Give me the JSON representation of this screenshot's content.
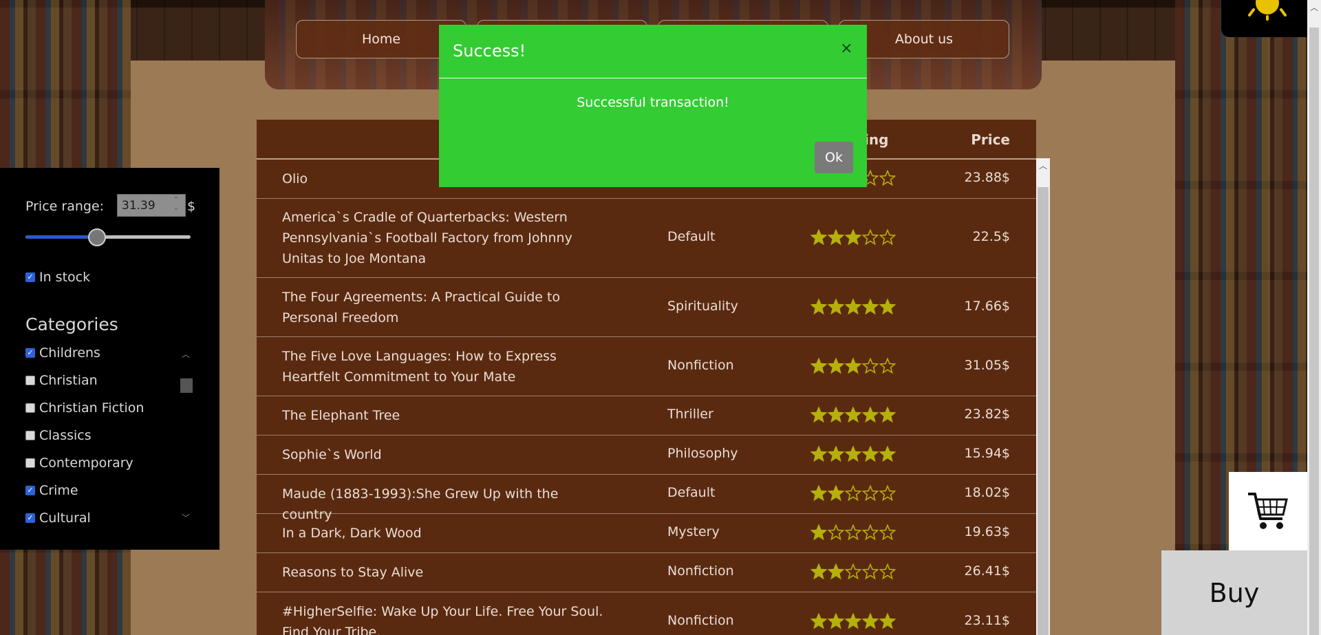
{
  "nav": {
    "items": [
      "Home",
      "",
      "",
      "About us"
    ]
  },
  "filters": {
    "price_label": "Price range:",
    "price_value": "31.39",
    "currency": "$",
    "slider_fraction": 0.43,
    "in_stock_label": "In stock",
    "in_stock_checked": true,
    "categories_title": "Categories",
    "categories": [
      {
        "label": "Childrens",
        "checked": true
      },
      {
        "label": "Christian",
        "checked": false
      },
      {
        "label": "Christian Fiction",
        "checked": false
      },
      {
        "label": "Classics",
        "checked": false
      },
      {
        "label": "Contemporary",
        "checked": false
      },
      {
        "label": "Crime",
        "checked": true
      },
      {
        "label": "Cultural",
        "checked": true
      }
    ]
  },
  "table": {
    "headers": {
      "rating": "ing",
      "price": "Price"
    },
    "rows": [
      {
        "title": "Olio",
        "category": "",
        "rating": 3,
        "price": "23.88$"
      },
      {
        "title": "America`s Cradle of Quarterbacks: Western Pennsylvania`s Football Factory from Johnny Unitas to Joe Montana",
        "category": "Default",
        "rating": 3,
        "price": "22.5$"
      },
      {
        "title": "The Four Agreements: A Practical Guide to Personal Freedom",
        "category": "Spirituality",
        "rating": 5,
        "price": "17.66$"
      },
      {
        "title": "The Five Love Languages: How to Express Heartfelt Commitment to Your Mate",
        "category": "Nonfiction",
        "rating": 3,
        "price": "31.05$"
      },
      {
        "title": "The Elephant Tree",
        "category": "Thriller",
        "rating": 5,
        "price": "23.82$"
      },
      {
        "title": "Sophie`s World",
        "category": "Philosophy",
        "rating": 5,
        "price": "15.94$"
      },
      {
        "title": "Maude (1883-1993):She Grew Up with the country",
        "category": "Default",
        "rating": 2,
        "price": "18.02$"
      },
      {
        "title": "In a Dark, Dark Wood",
        "category": "Mystery",
        "rating": 1,
        "price": "19.63$"
      },
      {
        "title": "Reasons to Stay Alive",
        "category": "Nonfiction",
        "rating": 2,
        "price": "26.41$"
      },
      {
        "title": "#HigherSelfie: Wake Up Your Life. Free Your Soul. Find Your Tribe.",
        "category": "Nonfiction",
        "rating": 5,
        "price": "23.11$"
      }
    ]
  },
  "modal": {
    "title": "Success!",
    "close": "×",
    "message": "Successful transaction!",
    "ok_label": "Ok"
  },
  "buy_label": "Buy",
  "icons": {
    "theme": "sun-icon",
    "cart": "cart-icon"
  },
  "colors": {
    "modal_bg": "#33cc33",
    "star": "#b5b00a",
    "table_bg": "#5a2a10"
  }
}
